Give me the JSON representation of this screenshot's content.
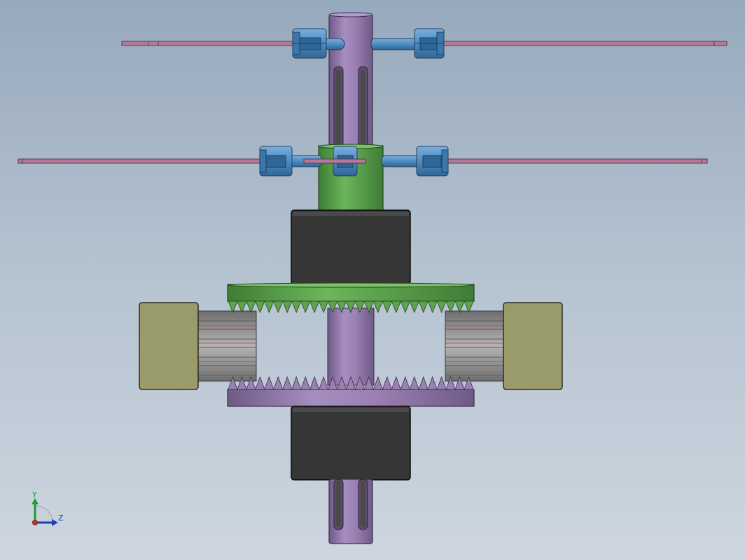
{
  "viewport": {
    "background_top": "#97a9bd",
    "background_bottom": "#cdd6e0"
  },
  "parts": {
    "shaft_color": "#9a80b3",
    "upper_collar_color": "#5fa24f",
    "motor_housing_color": "#363636",
    "gear_top_color": "#5fa24f",
    "gear_bottom_color": "#9a80b3",
    "blade_color": "#b07a98",
    "linkage_color": "#4f8cc0",
    "side_block_color": "#9a9b6a",
    "pinion_color": "#8e8e8e"
  },
  "triad": {
    "y_label": "Y",
    "z_label": "Z",
    "y_color": "#1f9a3a",
    "z_color": "#1d3fb6",
    "origin_color": "#c0392b"
  }
}
